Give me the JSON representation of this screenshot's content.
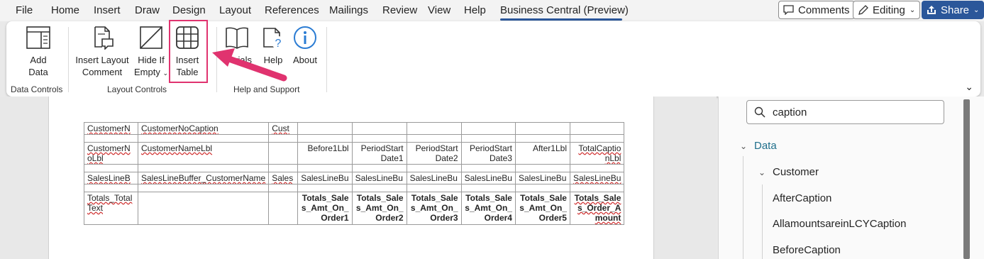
{
  "menu": {
    "tabs": [
      "File",
      "Home",
      "Insert",
      "Draw",
      "Design",
      "Layout",
      "References",
      "Mailings",
      "Review",
      "View",
      "Help",
      "Business Central (Preview)"
    ],
    "comments_label": "Comments",
    "editing_label": "Editing",
    "share_label": "Share"
  },
  "ribbon": {
    "add_data": [
      "Add",
      "Data"
    ],
    "insert_layout_comment": [
      "Insert Layout",
      "Comment"
    ],
    "hide_if_empty": [
      "Hide If",
      "Empty"
    ],
    "insert_table": [
      "Insert",
      "Table"
    ],
    "tutorials_partial": "rials",
    "help": "Help",
    "about": "About",
    "groups": [
      "Data Controls",
      "Layout Controls",
      "Help and Support"
    ]
  },
  "table": {
    "row1": [
      "CustomerN",
      "CustomerNoCaption",
      "Cust"
    ],
    "row3": [
      "CustomerN oLbl",
      "CustomerNameLbl",
      "",
      "Before1Lbl",
      "PeriodStart Date1",
      "PeriodStart Date2",
      "PeriodStart Date3",
      "After1Lbl",
      "TotalCaptio nLbl"
    ],
    "row5": [
      "SalesLineB",
      "SalesLineBuffer_CustomerName",
      "Sales",
      "SalesLineBu",
      "SalesLineBu",
      "SalesLineBu",
      "SalesLineBu",
      "SalesLineBu",
      "SalesLineBu"
    ],
    "row7": [
      "Totals_Total Text",
      "",
      "",
      "Totals_Sale s_Amt_On_ Order1",
      "Totals_Sale s_Amt_On_ Order2",
      "Totals_Sale s_Amt_On_ Order3",
      "Totals_Sale s_Amt_On_ Order4",
      "Totals_Sale s_Amt_On_ Order5",
      "Totals_Sale s_Order_A mount"
    ]
  },
  "pane": {
    "search_value": "caption",
    "tree": {
      "root": "Data",
      "child": "Customer",
      "leaves": [
        "AfterCaption",
        "AllamountsareinLCYCaption",
        "BeforeCaption"
      ]
    }
  }
}
